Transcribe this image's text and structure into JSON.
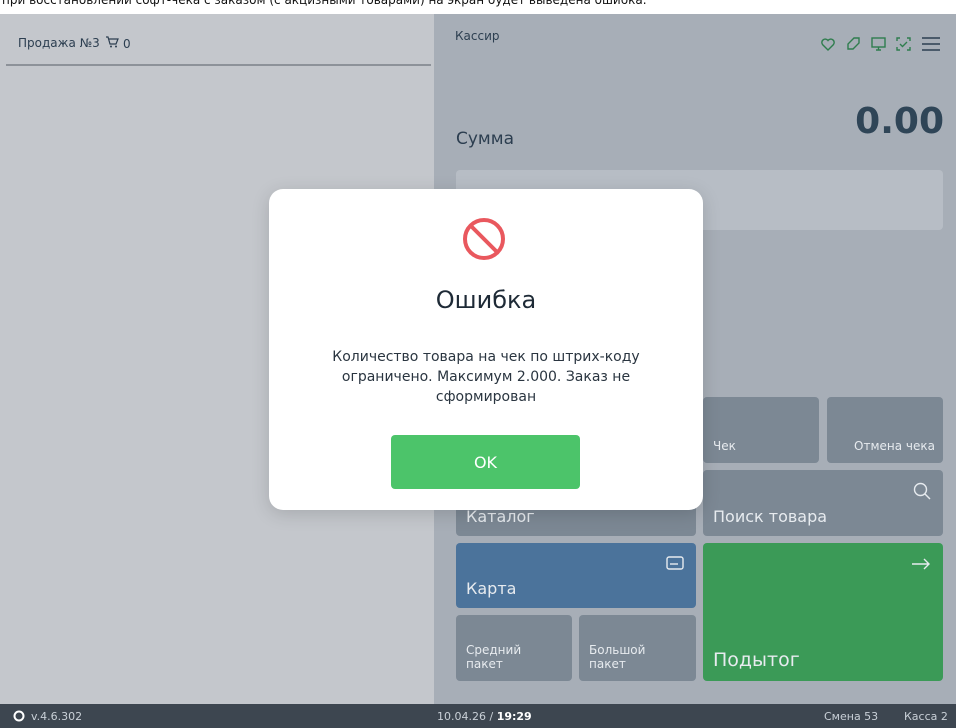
{
  "caption": "при восстановлении софт-чека с заказом (с акцизными товарами) на экран будет выведена ошибка.",
  "cart": {
    "sale_title": "Продажа №3",
    "item_count": "0"
  },
  "header": {
    "role": "Кассир",
    "icons": [
      "heart-icon",
      "tag-icon",
      "monitor-icon",
      "scan-icon",
      "menu-icon"
    ]
  },
  "summary": {
    "label": "Сумма",
    "value": "0.00"
  },
  "tiles": {
    "check": "Чек",
    "cancel_check": "Отмена чека",
    "catalog": "Каталог",
    "search": "Поиск товара",
    "card": "Карта",
    "subtotal": "Подытог",
    "medium_bag": "Средний пакет",
    "large_bag": "Большой пакет"
  },
  "footer": {
    "version": "v.4.6.302",
    "date": "10.04.26",
    "separator": " / ",
    "time": "19:29",
    "shift": "Смена 53",
    "register": "Касса 2"
  },
  "dialog": {
    "title": "Ошибка",
    "message": "Количество товара на чек по штрих-коду ограничено. Максимум 2.000. Заказ не сформирован",
    "ok_label": "OK"
  },
  "colors": {
    "ok_green": "#4cc46a",
    "error_red": "#e9585e",
    "subtotal_green": "#3b9a57",
    "card_blue": "#4b739b"
  }
}
